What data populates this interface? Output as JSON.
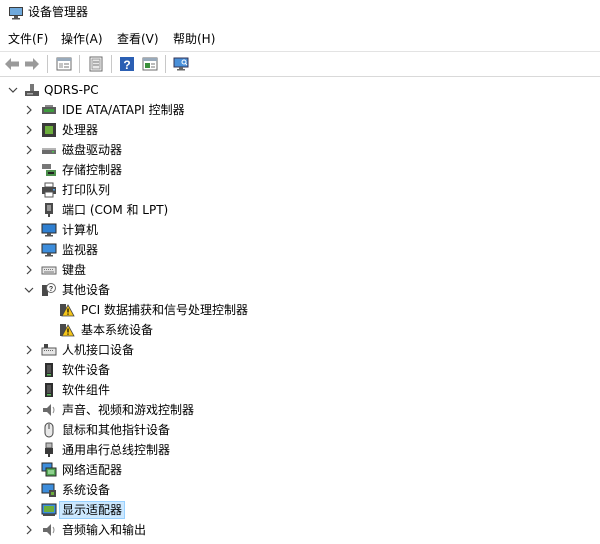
{
  "window": {
    "title": "设备管理器"
  },
  "menu": [
    "文件(F)",
    "操作(A)",
    "查看(V)",
    "帮助(H)"
  ],
  "toolbar": {
    "buttons": [
      "back-arrow-icon",
      "forward-arrow-icon",
      "properties-icon",
      "update-driver-icon",
      "help-icon",
      "show-hidden-icon",
      "monitor-scan-icon"
    ]
  },
  "tree": {
    "root": "QDRS-PC",
    "nodes": [
      {
        "label": "IDE ATA/ATAPI 控制器",
        "icon": "ide-controller-icon"
      },
      {
        "label": "处理器",
        "icon": "processor-icon"
      },
      {
        "label": "磁盘驱动器",
        "icon": "disk-drive-icon"
      },
      {
        "label": "存储控制器",
        "icon": "storage-controller-icon"
      },
      {
        "label": "打印队列",
        "icon": "printer-icon"
      },
      {
        "label": "端口 (COM 和 LPT)",
        "icon": "port-icon"
      },
      {
        "label": "计算机",
        "icon": "computer-icon"
      },
      {
        "label": "监视器",
        "icon": "monitor-icon"
      },
      {
        "label": "键盘",
        "icon": "keyboard-icon"
      },
      {
        "label": "其他设备",
        "icon": "unknown-device-icon",
        "expanded": true,
        "children": [
          {
            "label": "PCI 数据捕获和信号处理控制器",
            "icon": "warning-device-icon"
          },
          {
            "label": "基本系统设备",
            "icon": "warning-device-icon"
          }
        ]
      },
      {
        "label": "人机接口设备",
        "icon": "hid-icon"
      },
      {
        "label": "软件设备",
        "icon": "software-device-icon"
      },
      {
        "label": "软件组件",
        "icon": "software-component-icon"
      },
      {
        "label": "声音、视频和游戏控制器",
        "icon": "speaker-icon"
      },
      {
        "label": "鼠标和其他指针设备",
        "icon": "mouse-icon"
      },
      {
        "label": "通用串行总线控制器",
        "icon": "usb-icon"
      },
      {
        "label": "网络适配器",
        "icon": "network-adapter-icon"
      },
      {
        "label": "系统设备",
        "icon": "system-device-icon"
      },
      {
        "label": "显示适配器",
        "icon": "display-adapter-icon",
        "selected": true
      },
      {
        "label": "音频输入和输出",
        "icon": "speaker-icon"
      }
    ]
  },
  "colors": {
    "selection": "#cce8ff",
    "selection_border": "#99d1ff",
    "accent": "#0078d7"
  }
}
